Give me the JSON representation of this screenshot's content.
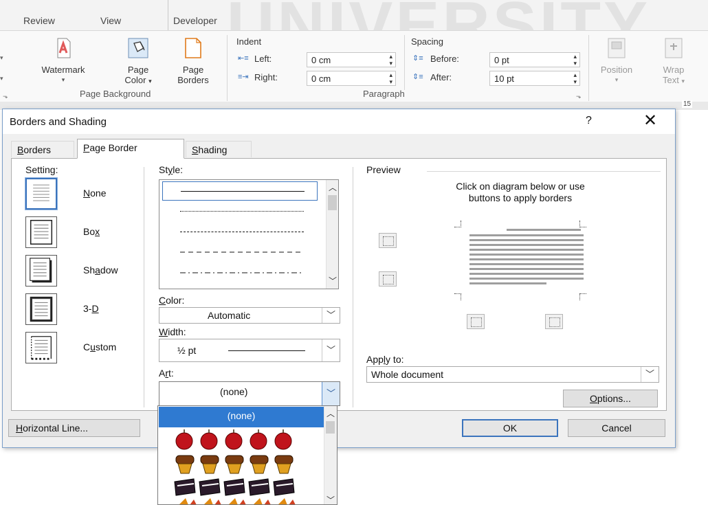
{
  "ribbon": {
    "tabs": [
      "Review",
      "View",
      "Developer"
    ],
    "page_background": {
      "group_label": "Page Background",
      "watermark_label": "Watermark",
      "page_color_label_1": "Page",
      "page_color_label_2": "Color",
      "page_borders_label_1": "Page",
      "page_borders_label_2": "Borders"
    },
    "paragraph": {
      "group_label": "Paragraph",
      "indent_label": "Indent",
      "left_label": "Left:",
      "left_value": "0 cm",
      "right_label": "Right:",
      "right_value": "0 cm",
      "spacing_label": "Spacing",
      "before_label": "Before:",
      "before_value": "0 pt",
      "after_label": "After:",
      "after_value": "10 pt"
    },
    "arrange": {
      "position_label": "Position",
      "wrap_label_1": "Wrap",
      "wrap_label_2": "Text"
    },
    "ruler_number": "15"
  },
  "dialog": {
    "title": "Borders and Shading",
    "help": "?",
    "close": "✕",
    "tabs": [
      {
        "label_pre": "",
        "accel": "B",
        "label_post": "orders"
      },
      {
        "label_pre": "",
        "accel": "P",
        "label_post": "age Border"
      },
      {
        "label_pre": "",
        "accel": "S",
        "label_post": "hading"
      }
    ],
    "setting": {
      "label": "Setting:",
      "items": [
        {
          "pre": "",
          "accel": "N",
          "post": "one"
        },
        {
          "pre": "Bo",
          "accel": "x",
          "post": ""
        },
        {
          "pre": "Sh",
          "accel": "a",
          "post": "dow"
        },
        {
          "pre": "3-",
          "accel": "D",
          "post": ""
        },
        {
          "pre": "C",
          "accel": "u",
          "post": "stom"
        }
      ]
    },
    "style": {
      "label_pre": "St",
      "label_accel": "y",
      "label_post": "le:",
      "line_styles": [
        "solid",
        "dotted",
        "dashed-small",
        "dashed",
        "dash-dot"
      ]
    },
    "color": {
      "label_pre": "",
      "label_accel": "C",
      "label_post": "olor:",
      "value": "Automatic"
    },
    "width": {
      "label_pre": "",
      "label_accel": "W",
      "label_post": "idth:",
      "value": "½ pt"
    },
    "art": {
      "label_pre": "A",
      "label_accel": "r",
      "label_post": "t:",
      "value": "(none)",
      "list_selected": "(none)"
    },
    "preview": {
      "label": "Preview",
      "hint_line1": "Click on diagram below or use",
      "hint_line2": "buttons to apply borders"
    },
    "apply_to": {
      "label_pre": "App",
      "label_accel": "l",
      "label_post": "y to:",
      "value": "Whole document"
    },
    "options_button": {
      "pre": "",
      "accel": "O",
      "post": "ptions..."
    },
    "horizontal_line_button": {
      "pre": "",
      "accel": "H",
      "post": "orizontal Line..."
    },
    "ok_button": "OK",
    "cancel_button": "Cancel"
  },
  "colors": {
    "accent_blue": "#2f7ad1",
    "selected_border": "#3b74bd",
    "dialog_bg": "#f0f0f0"
  }
}
